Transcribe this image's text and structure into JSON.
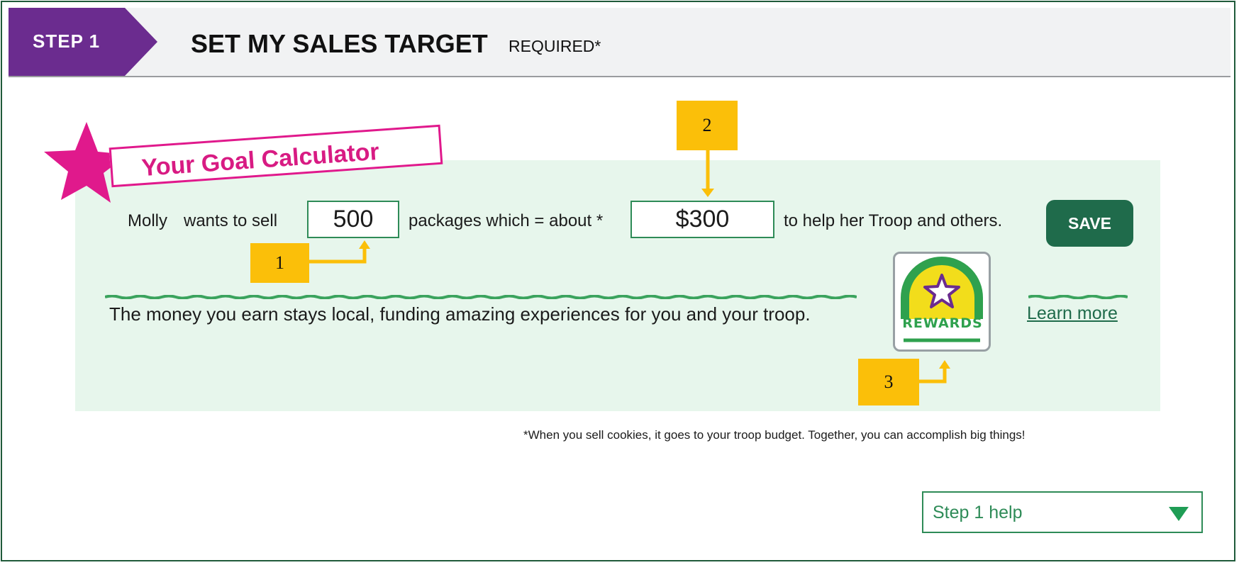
{
  "step": {
    "badge": "STEP 1",
    "title": "SET MY SALES TARGET",
    "required": "REQUIRED*"
  },
  "calculator": {
    "title": "Your Goal Calculator",
    "name": "Molly",
    "wants_to_sell": "wants to sell",
    "packages_value": "500",
    "packages_which": "packages which = about *",
    "amount_value": "$300",
    "help_text": "to help her Troop and others.",
    "save_label": "SAVE"
  },
  "info": {
    "money_text": "The money you earn stays local, funding amazing experiences for you and your troop.",
    "rewards_label": "REWARDS",
    "learn_more": "Learn more"
  },
  "footnote": "*When you sell cookies, it goes to your troop budget. Together, you can accomplish big things!",
  "help_dropdown": {
    "selected": "Step 1 help"
  },
  "callouts": [
    "1",
    "2",
    "3"
  ],
  "colors": {
    "step_badge": "#6b2c8f",
    "accent_pink": "#e0198c",
    "panel_bg": "#e7f6ec",
    "brand_green": "#1f6b4b",
    "callout": "#fbbf09"
  }
}
